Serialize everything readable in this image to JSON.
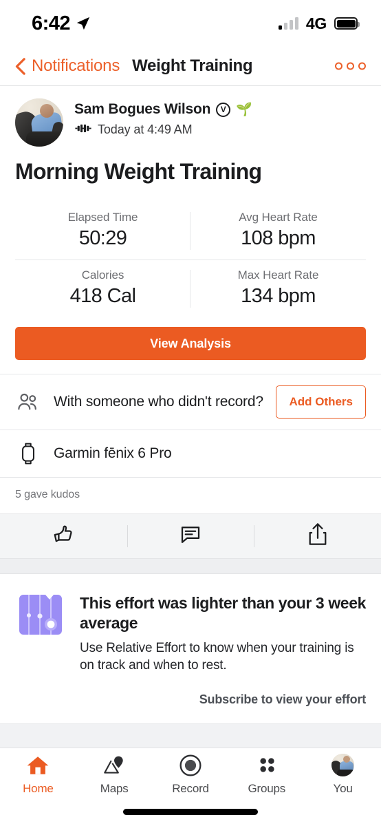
{
  "status_bar": {
    "time": "6:42",
    "location_icon": "location-arrow-icon",
    "signal_icon": "cellular-signal-icon",
    "network": "4G",
    "battery_icon": "battery-full-icon"
  },
  "nav": {
    "back_label": "Notifications",
    "title": "Weight Training",
    "more_icon": "overflow-menu-icon"
  },
  "athlete": {
    "avatar_alt": "athlete-avatar",
    "name": "Sam Bogues Wilson",
    "verified_badge": "V",
    "emoji": "🌱",
    "activity_type_icon": "dumbbell-icon",
    "date": "Today at 4:49 AM"
  },
  "activity": {
    "title": "Morning Weight Training",
    "stats": [
      {
        "label": "Elapsed Time",
        "value": "50:29"
      },
      {
        "label": "Avg Heart Rate",
        "value": "108 bpm"
      },
      {
        "label": "Calories",
        "value": "418 Cal"
      },
      {
        "label": "Max Heart Rate",
        "value": "134 bpm"
      }
    ],
    "view_analysis_label": "View Analysis"
  },
  "add_others": {
    "icon": "people-icon",
    "text": "With someone who didn't record?",
    "button_label": "Add Others"
  },
  "device": {
    "icon": "watch-icon",
    "name": "Garmin fēnix 6 Pro"
  },
  "social": {
    "kudos_text": "5 gave kudos",
    "actions": [
      {
        "name": "kudos-icon",
        "label": "Kudos"
      },
      {
        "name": "comment-icon",
        "label": "Comment"
      },
      {
        "name": "share-icon",
        "label": "Share"
      }
    ]
  },
  "promo": {
    "icon": "relative-effort-icon",
    "title": "This effort was lighter than your 3 week average",
    "subtitle": "Use Relative Effort to know when your training is on track and when to rest.",
    "cta": "Subscribe to view your effort"
  },
  "tabbar": {
    "items": [
      {
        "label": "Home",
        "icon": "home-icon",
        "active": true
      },
      {
        "label": "Maps",
        "icon": "maps-icon",
        "active": false
      },
      {
        "label": "Record",
        "icon": "record-icon",
        "active": false
      },
      {
        "label": "Groups",
        "icon": "groups-icon",
        "active": false
      },
      {
        "label": "You",
        "icon": "profile-avatar-icon",
        "active": false
      }
    ]
  },
  "colors": {
    "brand_orange": "#eb5b22",
    "nav_orange": "#ec602a",
    "promo_purple": "#9b8df5",
    "text_primary": "#1c1d1f",
    "text_muted": "#6d6e72",
    "surface_gray": "#f4f5f6"
  }
}
